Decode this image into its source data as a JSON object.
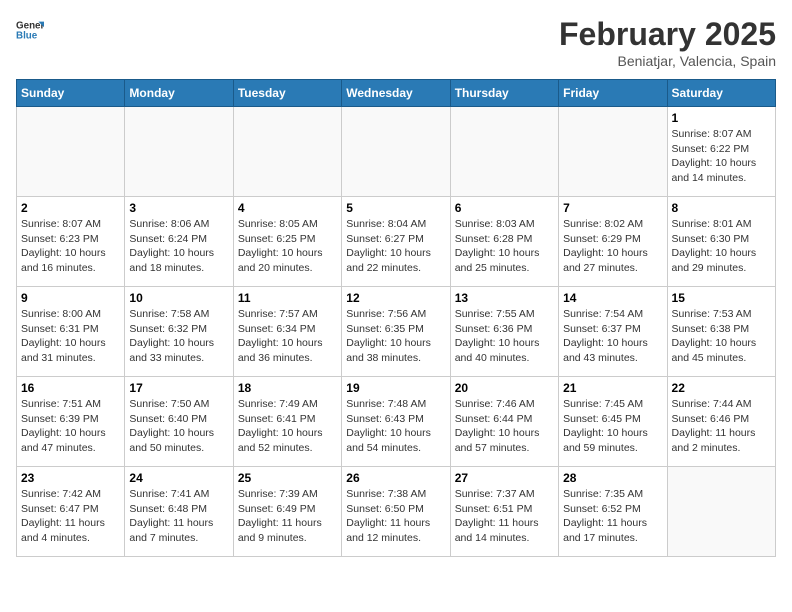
{
  "logo": {
    "general": "General",
    "blue": "Blue"
  },
  "title": "February 2025",
  "subtitle": "Beniatjar, Valencia, Spain",
  "days": [
    "Sunday",
    "Monday",
    "Tuesday",
    "Wednesday",
    "Thursday",
    "Friday",
    "Saturday"
  ],
  "weeks": [
    [
      {
        "day": "",
        "info": ""
      },
      {
        "day": "",
        "info": ""
      },
      {
        "day": "",
        "info": ""
      },
      {
        "day": "",
        "info": ""
      },
      {
        "day": "",
        "info": ""
      },
      {
        "day": "",
        "info": ""
      },
      {
        "day": "1",
        "info": "Sunrise: 8:07 AM\nSunset: 6:22 PM\nDaylight: 10 hours and 14 minutes."
      }
    ],
    [
      {
        "day": "2",
        "info": "Sunrise: 8:07 AM\nSunset: 6:23 PM\nDaylight: 10 hours and 16 minutes."
      },
      {
        "day": "3",
        "info": "Sunrise: 8:06 AM\nSunset: 6:24 PM\nDaylight: 10 hours and 18 minutes."
      },
      {
        "day": "4",
        "info": "Sunrise: 8:05 AM\nSunset: 6:25 PM\nDaylight: 10 hours and 20 minutes."
      },
      {
        "day": "5",
        "info": "Sunrise: 8:04 AM\nSunset: 6:27 PM\nDaylight: 10 hours and 22 minutes."
      },
      {
        "day": "6",
        "info": "Sunrise: 8:03 AM\nSunset: 6:28 PM\nDaylight: 10 hours and 25 minutes."
      },
      {
        "day": "7",
        "info": "Sunrise: 8:02 AM\nSunset: 6:29 PM\nDaylight: 10 hours and 27 minutes."
      },
      {
        "day": "8",
        "info": "Sunrise: 8:01 AM\nSunset: 6:30 PM\nDaylight: 10 hours and 29 minutes."
      }
    ],
    [
      {
        "day": "9",
        "info": "Sunrise: 8:00 AM\nSunset: 6:31 PM\nDaylight: 10 hours and 31 minutes."
      },
      {
        "day": "10",
        "info": "Sunrise: 7:58 AM\nSunset: 6:32 PM\nDaylight: 10 hours and 33 minutes."
      },
      {
        "day": "11",
        "info": "Sunrise: 7:57 AM\nSunset: 6:34 PM\nDaylight: 10 hours and 36 minutes."
      },
      {
        "day": "12",
        "info": "Sunrise: 7:56 AM\nSunset: 6:35 PM\nDaylight: 10 hours and 38 minutes."
      },
      {
        "day": "13",
        "info": "Sunrise: 7:55 AM\nSunset: 6:36 PM\nDaylight: 10 hours and 40 minutes."
      },
      {
        "day": "14",
        "info": "Sunrise: 7:54 AM\nSunset: 6:37 PM\nDaylight: 10 hours and 43 minutes."
      },
      {
        "day": "15",
        "info": "Sunrise: 7:53 AM\nSunset: 6:38 PM\nDaylight: 10 hours and 45 minutes."
      }
    ],
    [
      {
        "day": "16",
        "info": "Sunrise: 7:51 AM\nSunset: 6:39 PM\nDaylight: 10 hours and 47 minutes."
      },
      {
        "day": "17",
        "info": "Sunrise: 7:50 AM\nSunset: 6:40 PM\nDaylight: 10 hours and 50 minutes."
      },
      {
        "day": "18",
        "info": "Sunrise: 7:49 AM\nSunset: 6:41 PM\nDaylight: 10 hours and 52 minutes."
      },
      {
        "day": "19",
        "info": "Sunrise: 7:48 AM\nSunset: 6:43 PM\nDaylight: 10 hours and 54 minutes."
      },
      {
        "day": "20",
        "info": "Sunrise: 7:46 AM\nSunset: 6:44 PM\nDaylight: 10 hours and 57 minutes."
      },
      {
        "day": "21",
        "info": "Sunrise: 7:45 AM\nSunset: 6:45 PM\nDaylight: 10 hours and 59 minutes."
      },
      {
        "day": "22",
        "info": "Sunrise: 7:44 AM\nSunset: 6:46 PM\nDaylight: 11 hours and 2 minutes."
      }
    ],
    [
      {
        "day": "23",
        "info": "Sunrise: 7:42 AM\nSunset: 6:47 PM\nDaylight: 11 hours and 4 minutes."
      },
      {
        "day": "24",
        "info": "Sunrise: 7:41 AM\nSunset: 6:48 PM\nDaylight: 11 hours and 7 minutes."
      },
      {
        "day": "25",
        "info": "Sunrise: 7:39 AM\nSunset: 6:49 PM\nDaylight: 11 hours and 9 minutes."
      },
      {
        "day": "26",
        "info": "Sunrise: 7:38 AM\nSunset: 6:50 PM\nDaylight: 11 hours and 12 minutes."
      },
      {
        "day": "27",
        "info": "Sunrise: 7:37 AM\nSunset: 6:51 PM\nDaylight: 11 hours and 14 minutes."
      },
      {
        "day": "28",
        "info": "Sunrise: 7:35 AM\nSunset: 6:52 PM\nDaylight: 11 hours and 17 minutes."
      },
      {
        "day": "",
        "info": ""
      }
    ]
  ]
}
